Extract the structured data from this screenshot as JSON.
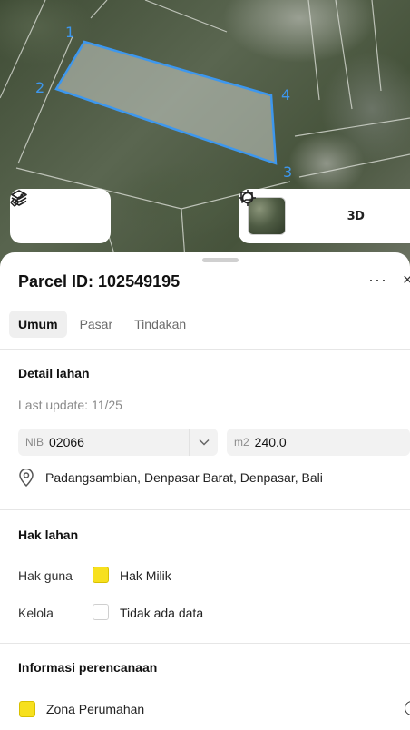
{
  "map": {
    "vertices": [
      "1",
      "2",
      "3",
      "4"
    ],
    "accent_color": "#3d97ee",
    "left_controls": [
      {
        "icon": "layers-icon"
      },
      {
        "icon": "measure-icon"
      }
    ],
    "right_controls": [
      {
        "icon": "satellite-thumbnail"
      },
      {
        "icon": "crosshair-icon"
      },
      {
        "label": "3D"
      },
      {
        "icon": "chat-icon"
      }
    ]
  },
  "sheet": {
    "title": "Parcel ID: 102549195",
    "more_label": "···",
    "close_label": "×",
    "tabs": [
      {
        "label": "Umum",
        "active": true
      },
      {
        "label": "Pasar",
        "active": false
      },
      {
        "label": "Tindakan",
        "active": false
      }
    ],
    "detail": {
      "heading": "Detail lahan",
      "last_update": "Last update: 11/25",
      "nib_prefix": "NIB",
      "nib_value": "02066",
      "area_prefix": "m2",
      "area_value": "240.0",
      "address": "Padangsambian, Denpasar Barat, Denpasar, Bali"
    },
    "rights": {
      "heading": "Hak lahan",
      "rows": [
        {
          "label": "Hak guna",
          "value": "Hak Milik",
          "color": "#f7e01e"
        },
        {
          "label": "Kelola",
          "value": "Tidak ada data",
          "color": "#ffffff"
        }
      ]
    },
    "planning": {
      "heading": "Informasi perencanaan",
      "zone": "Zona Perumahan",
      "zone_color": "#f7e01e"
    }
  }
}
